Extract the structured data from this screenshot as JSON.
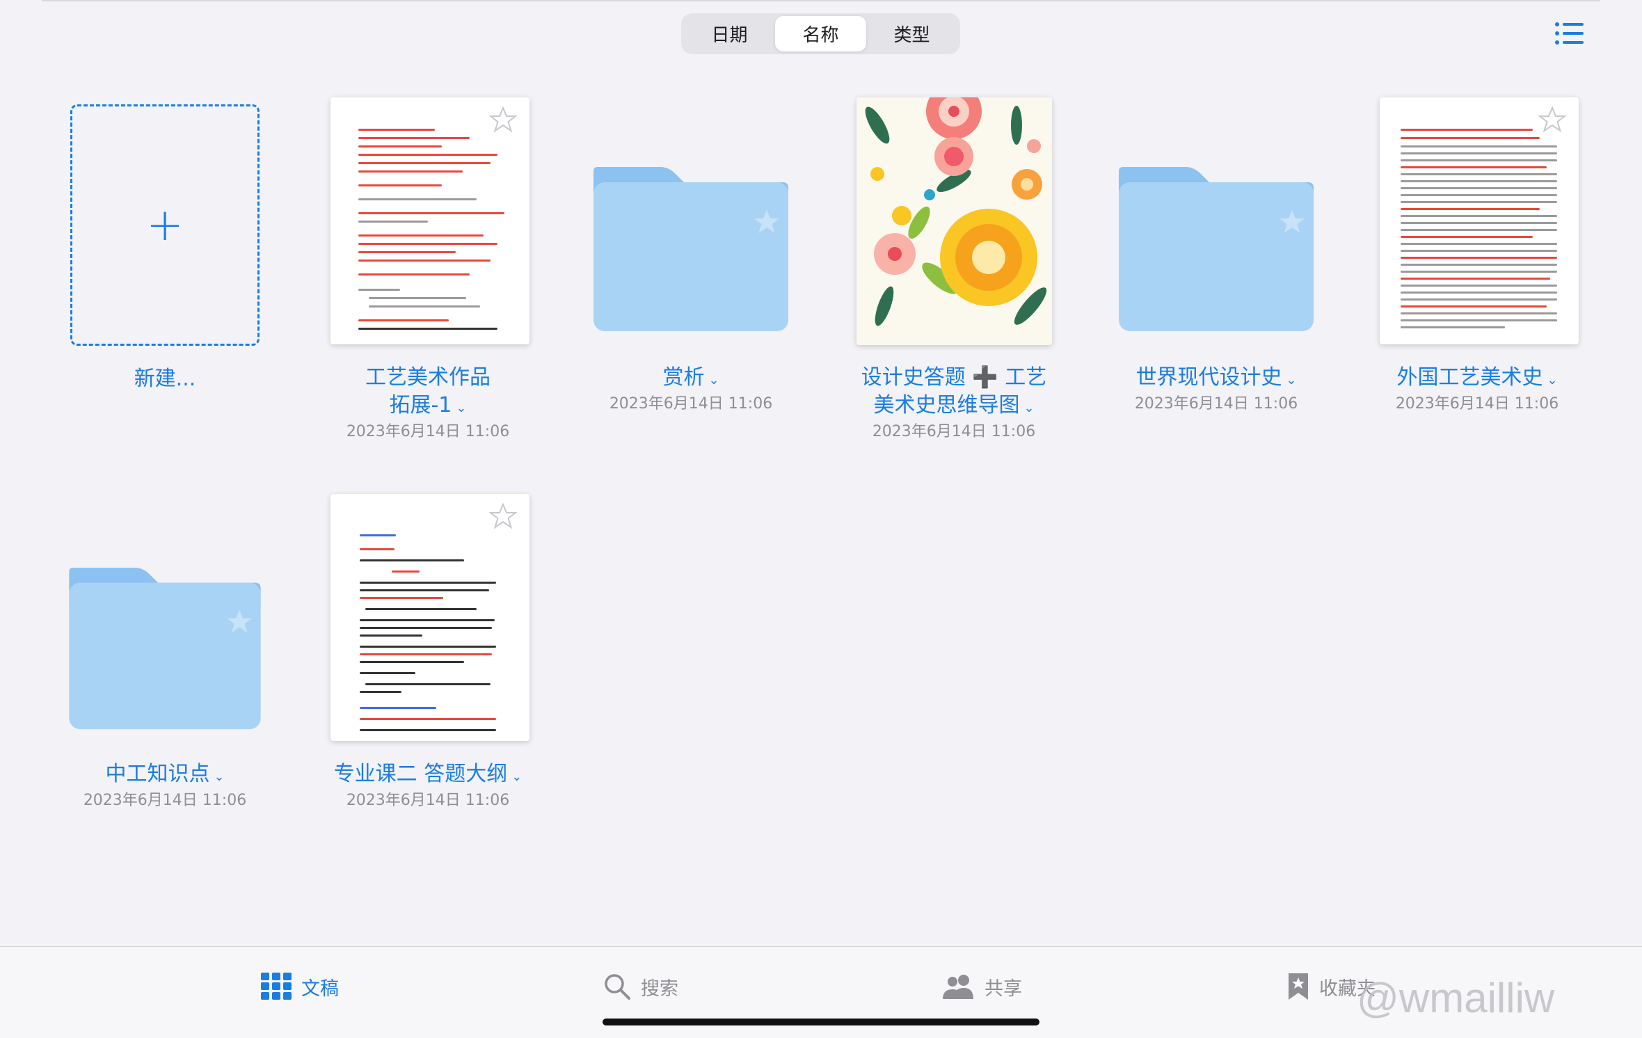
{
  "sort": {
    "options": [
      "日期",
      "名称",
      "类型"
    ],
    "selected": "名称"
  },
  "items": [
    {
      "kind": "new",
      "name": "新建..."
    },
    {
      "kind": "doc-red",
      "name_lines": [
        "工艺美术作品",
        "拓展-1"
      ],
      "date": "2023年6月14日 11:06"
    },
    {
      "kind": "folder",
      "name": "赏析",
      "date": "2023年6月14日 11:06"
    },
    {
      "kind": "floral",
      "name_lines": [
        "设计史答题 ➕ 工艺",
        "美术史思维导图"
      ],
      "date": "2023年6月14日 11:06"
    },
    {
      "kind": "folder",
      "name": "世界现代设计史",
      "date": "2023年6月14日 11:06"
    },
    {
      "kind": "doc-dense",
      "name": "外国工艺美术史",
      "date": "2023年6月14日 11:06"
    },
    {
      "kind": "folder",
      "name": "中工知识点",
      "date": "2023年6月14日 11:06"
    },
    {
      "kind": "doc-outline",
      "name": "专业课二 答题大纲",
      "date": "2023年6月14日 11:06"
    }
  ],
  "tabs": [
    {
      "label": "文稿",
      "icon": "grid-icon",
      "active": true
    },
    {
      "label": "搜索",
      "icon": "search-icon",
      "active": false
    },
    {
      "label": "共享",
      "icon": "people-icon",
      "active": false
    },
    {
      "label": "收藏夹",
      "icon": "bookmark-icon",
      "active": false
    }
  ],
  "watermark": "@wmailliw",
  "colors": {
    "accent": "#1a7de0",
    "folder": "#a9d3f5",
    "folder_tab": "#8cc2ef",
    "background": "#f2f2f7"
  }
}
